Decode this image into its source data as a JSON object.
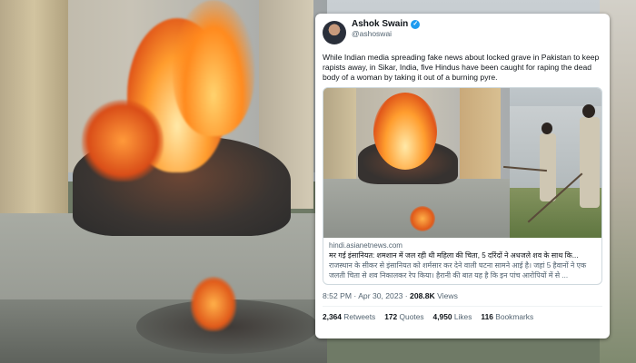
{
  "tweet": {
    "display_name": "Ashok Swain",
    "handle": "@ashoswai",
    "verified_badge": "✓",
    "text": "While Indian media spreading fake news about locked grave in Pakistan to keep rapists away, in Sikar, India, five Hindus have been caught for raping the dead body of a woman by taking it out of a burning pyre.",
    "link": {
      "domain": "hindi.asianetnews.com",
      "title": "मर गई इंसानियत: शमशान में जल रही थी महिला की चिता, 5 दरिंदों ने अधजले शव के साथ कि...",
      "description": "राजस्थान के सीकर से इंसानियत को शर्मसार कर देने वाली घटना सामने आई है। जहां 5 हैवानों ने एक जलती चिता से शव निकालकर रेप किया। हैरानी की बात यह है कि इन पांच आरोपियों में से ..."
    },
    "time": "8:52 PM",
    "date": "Apr 30, 2023",
    "views_count": "208.8K",
    "views_label": "Views",
    "retweets_count": "2,364",
    "retweets_label": "Retweets",
    "quotes_count": "172",
    "quotes_label": "Quotes",
    "likes_count": "4,950",
    "likes_label": "Likes",
    "bookmarks_count": "116",
    "bookmarks_label": "Bookmarks"
  },
  "colors": {
    "accent": "#1d9bf0",
    "text_primary": "#0f1419",
    "text_secondary": "#536471"
  }
}
